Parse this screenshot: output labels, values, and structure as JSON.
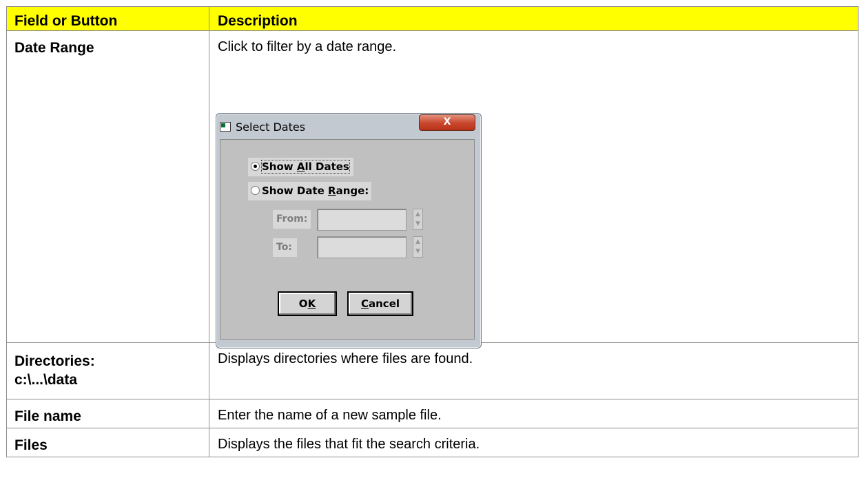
{
  "table": {
    "headers": {
      "field": "Field or Button",
      "description": "Description"
    },
    "rows": [
      {
        "field": "Date Range",
        "description": "Click to filter by a date range."
      },
      {
        "field_line1": "Directories:",
        "field_line2": "c:\\...\\data",
        "description": "Displays directories where files are found."
      },
      {
        "field": "File name",
        "description": "Enter the name of a new sample file."
      },
      {
        "field": "Files",
        "description": "Displays the files that fit the search criteria."
      }
    ]
  },
  "dialog": {
    "title": "Select Dates",
    "close_label": "X",
    "options": {
      "all_dates": {
        "pre": "Show ",
        "mnemonic": "A",
        "post": "ll Dates",
        "selected": true
      },
      "date_range": {
        "pre": "Show Date ",
        "mnemonic": "R",
        "post": "ange:",
        "selected": false
      }
    },
    "from_label": "From:",
    "to_label": "To:",
    "from_value": "",
    "to_value": "",
    "spin_up": "▲",
    "spin_down": "▼",
    "ok": {
      "pre": "O",
      "mnemonic": "K",
      "post": ""
    },
    "cancel": {
      "pre": "",
      "mnemonic": "C",
      "post": "ancel"
    }
  },
  "colors": {
    "header_bg": "#ffff00",
    "border": "#8c8c8c",
    "dialog_bg": "#c0c0c0",
    "close_red": "#c9452c"
  }
}
